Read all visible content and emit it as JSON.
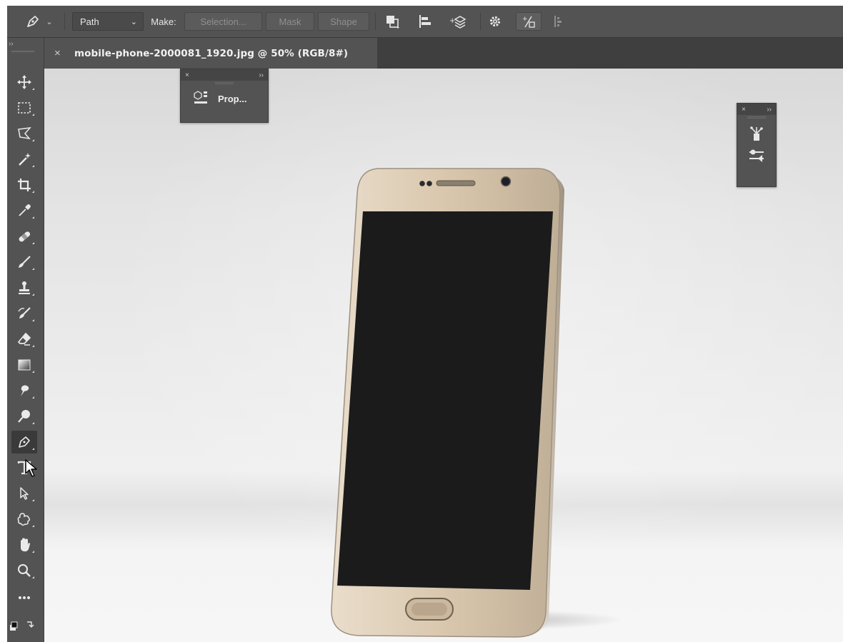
{
  "options_bar": {
    "tool_preset_icon": "pen-icon",
    "mode_select": "Path",
    "make_label": "Make:",
    "selection_button": "Selection...",
    "mask_button": "Mask",
    "shape_button": "Shape",
    "icons": [
      "path-operations-icon",
      "path-alignment-icon",
      "path-arrangement-icon",
      "gear-icon",
      "auto-add-delete-icon",
      "align-edges-icon"
    ]
  },
  "document_tab": {
    "close_glyph": "×",
    "title": "mobile-phone-2000081_1920.jpg @ 50% (RGB/8#)"
  },
  "tools_panel": {
    "collapse_glyph": "››",
    "tools": [
      {
        "name": "move-tool",
        "icon": "move-icon"
      },
      {
        "name": "marquee-tool",
        "icon": "rectangular-marquee-icon"
      },
      {
        "name": "lasso-tool",
        "icon": "polygonal-lasso-icon"
      },
      {
        "name": "magic-wand-tool",
        "icon": "magic-wand-icon"
      },
      {
        "name": "crop-tool",
        "icon": "crop-icon"
      },
      {
        "name": "eyedropper-tool",
        "icon": "eyedropper-icon"
      },
      {
        "name": "healing-brush-tool",
        "icon": "bandage-icon"
      },
      {
        "name": "brush-tool",
        "icon": "brush-icon"
      },
      {
        "name": "clone-stamp-tool",
        "icon": "stamp-icon"
      },
      {
        "name": "history-brush-tool",
        "icon": "history-brush-icon"
      },
      {
        "name": "eraser-tool",
        "icon": "eraser-icon"
      },
      {
        "name": "gradient-tool",
        "icon": "gradient-icon"
      },
      {
        "name": "smudge-tool",
        "icon": "smudge-icon"
      },
      {
        "name": "dodge-tool",
        "icon": "dodge-icon"
      },
      {
        "name": "pen-tool",
        "icon": "pen-icon"
      },
      {
        "name": "type-tool",
        "icon": "type-icon"
      },
      {
        "name": "path-selection-tool",
        "icon": "arrow-icon"
      },
      {
        "name": "custom-shape-tool",
        "icon": "custom-shape-icon"
      },
      {
        "name": "hand-tool",
        "icon": "hand-icon"
      },
      {
        "name": "zoom-tool",
        "icon": "magnifier-icon"
      },
      {
        "name": "more-tools",
        "icon": "ellipsis-icon"
      },
      {
        "name": "swap-colors",
        "icon": "swap-colors-icon"
      }
    ]
  },
  "properties_panel": {
    "close_glyph": "×",
    "collapse_glyph": "››",
    "label": "Prop..."
  },
  "right_panel": {
    "close_glyph": "×",
    "collapse_glyph": "››",
    "icons": [
      "brushes-icon",
      "adjustments-icon"
    ]
  },
  "canvas_image": {
    "subject": "gold-smartphone",
    "background_color": "#e6e6e6",
    "phone_body_color": "#d8c6ae",
    "screen_color": "#1d1d1d"
  }
}
